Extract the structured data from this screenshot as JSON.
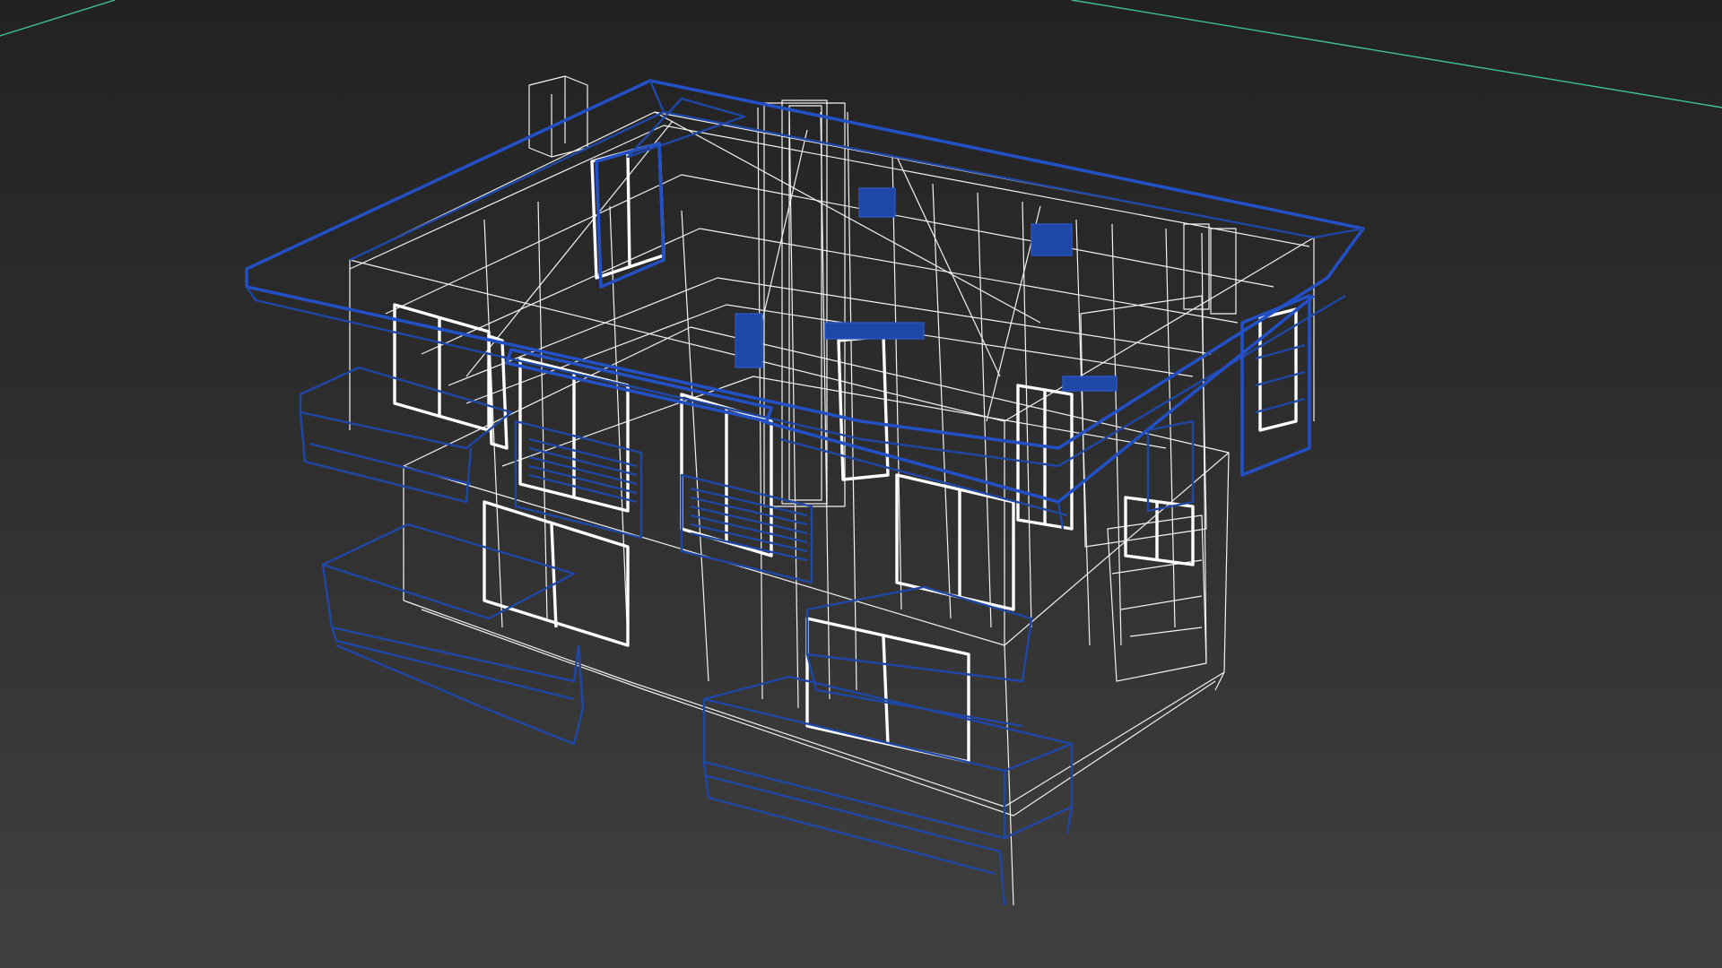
{
  "viewport": {
    "background_top": "#222222",
    "background_bottom": "#404040",
    "wire_white": "#f2f2f2",
    "wire_blue": "#1f47a6",
    "grid_axis": "#3fbf9c",
    "display_mode": "wireframe"
  }
}
